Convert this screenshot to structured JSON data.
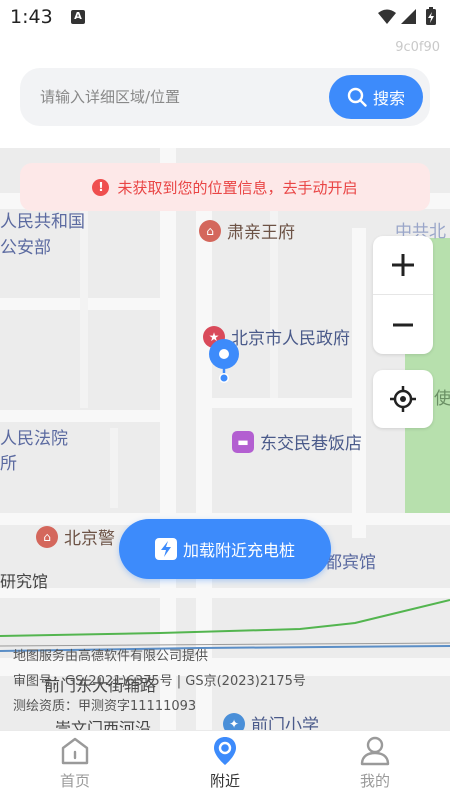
{
  "status_bar": {
    "time": "1:43",
    "notification_letter": "A"
  },
  "hash_code": "9c0f90",
  "search": {
    "placeholder": "请输入详细区域/位置",
    "button_label": "搜索"
  },
  "alert": {
    "message": "未获取到您的位置信息，去手动开启"
  },
  "map": {
    "pois": {
      "suqin": "肃亲王府",
      "beijing_gov": "北京市人民政府",
      "dongjiao": "东交民巷饭店",
      "beijing_jing": "北京警",
      "qianmen_school": "前门小学"
    },
    "labels": {
      "renmin_gonghe": "人民共和国",
      "gong_an_bu": "公安部",
      "fayuan": "人民法院",
      "suo": "所",
      "yanjiu_guan": "研究馆",
      "du_binguan": "都宾馆",
      "zhonggong_bei": "中共北",
      "shi": "使",
      "street": "前门东大街辅路",
      "bottom_road": "崇文门西河沿"
    },
    "attribution": [
      "地图服务由高德软件有限公司提供",
      "审图号：GS(2021)6375号 | GS京(2023)2175号",
      "测绘资质：甲测资字11111093"
    ],
    "load_button_label": "加载附近充电桩"
  },
  "bottom_nav": {
    "items": [
      {
        "label": "首页",
        "icon": "home-icon",
        "active": false
      },
      {
        "label": "附近",
        "icon": "location-pin-icon",
        "active": true
      },
      {
        "label": "我的",
        "icon": "user-icon",
        "active": false
      }
    ]
  },
  "colors": {
    "accent": "#3d8bfb",
    "alert_bg": "#fde8e8",
    "alert_text": "#e94545",
    "poi_red": "#d9534f",
    "poi_purple": "#b35fd1",
    "park_green": "#b7e0ad"
  }
}
